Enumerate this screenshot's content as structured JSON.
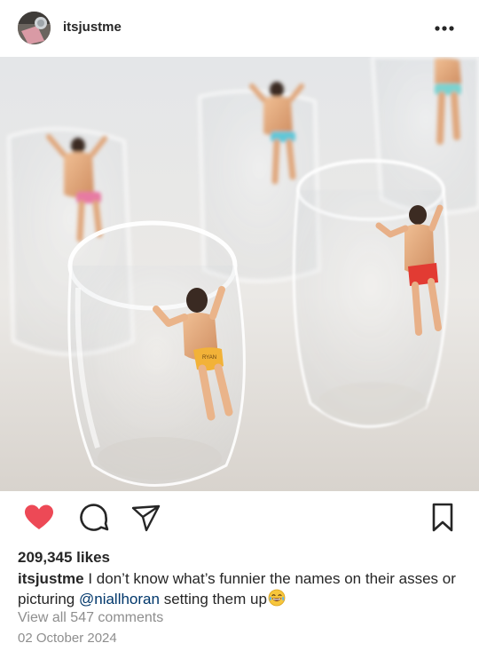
{
  "post": {
    "username": "itsjustme",
    "likes_text": "209,345 likes",
    "caption": {
      "username": "itsjustme",
      "text_before": " I don’t know what’s funnier the names on their asses or picturing ",
      "mention": "@niallhoran",
      "text_after": " setting them up",
      "emoji": "laughing-crying-emoji"
    },
    "view_comments_text": "View all 547 comments",
    "date_text": "02 October 2024",
    "liked": true,
    "photo_label": "RYAN"
  },
  "icons": {
    "more": "more-horizontal-icon",
    "like": "heart-icon",
    "comment": "comment-icon",
    "share": "send-icon",
    "save": "bookmark-icon"
  },
  "colors": {
    "like_red": "#ed4956",
    "mention_blue": "#00376b",
    "muted_gray": "#8e8e8e",
    "text": "#262626"
  }
}
